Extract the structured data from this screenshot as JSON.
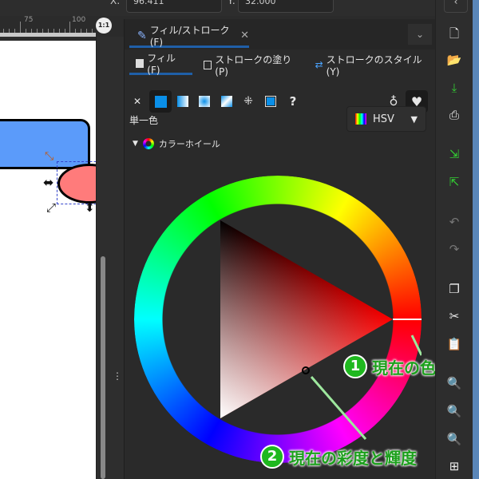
{
  "toolbar": {
    "x_label": "X:",
    "x_value": "96.411",
    "y_label": "Y:",
    "y_value": "32.000"
  },
  "ruler": {
    "labels": [
      "75",
      "100"
    ],
    "zoom_badge": "1:1"
  },
  "dialog": {
    "tab_title": "フィル/ストローク(F)",
    "subtabs": [
      "フィル(F)",
      "ストロークの塗り(P)",
      "ストロークのスタイル(Y)"
    ],
    "paint_types": [
      "no-paint",
      "flat-color",
      "linear-gradient",
      "radial-gradient",
      "mesh-gradient",
      "pattern",
      "swatch",
      "unset"
    ],
    "unset_label": "?",
    "flat_label": "単一色",
    "mode_select": "HSV",
    "wheel_section": "カラーホイール",
    "current_color": "#ff0000"
  },
  "annotations": [
    {
      "number": "1",
      "text": "現在の色相"
    },
    {
      "number": "2",
      "text": "現在の彩度と輝度"
    }
  ],
  "colors": {
    "accent": "#1f5fa8",
    "annotation": "#1ca01c",
    "shape_blue": "#5b9bfa",
    "shape_red": "#ff7b7b"
  }
}
